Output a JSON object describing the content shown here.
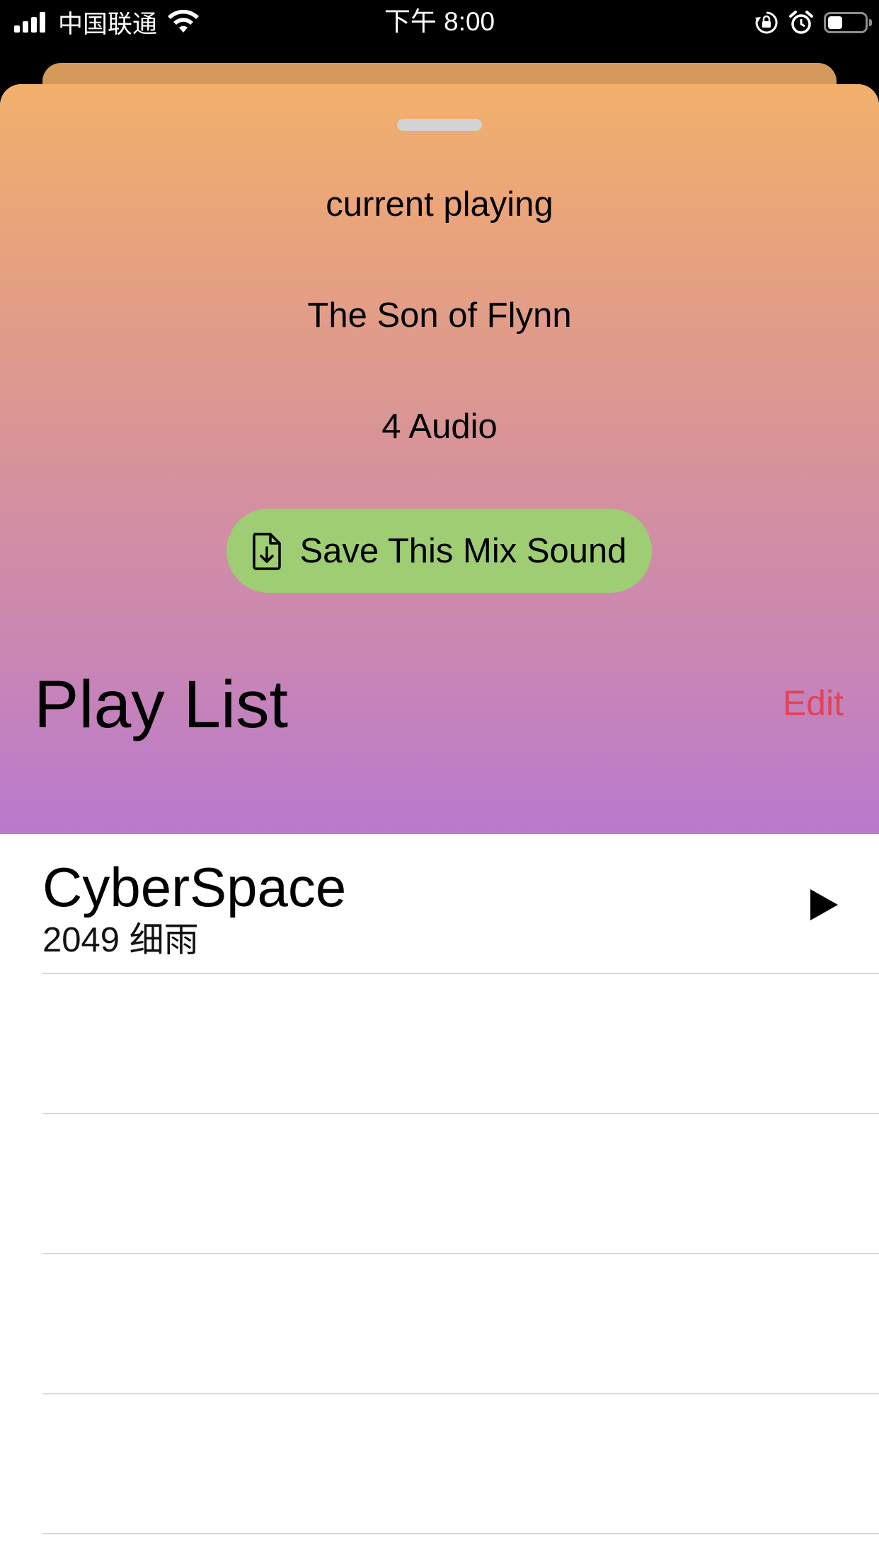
{
  "status_bar": {
    "carrier": "中国联通",
    "time": "下午 8:00",
    "battery_level_percent": 40,
    "icons": [
      "signal-bars-icon",
      "wifi-icon",
      "orientation-lock-icon",
      "alarm-icon",
      "battery-icon"
    ]
  },
  "sheet": {
    "current_label": "current playing",
    "mix_name": "The Son of Flynn",
    "audio_count": "4 Audio",
    "save_button": {
      "label": "Save This Mix Sound",
      "icon": "file-download-icon",
      "color": "#9ECD74"
    }
  },
  "playlist": {
    "title": "Play List",
    "edit_label": "Edit",
    "edit_color": "#E0445A",
    "items": [
      {
        "title": "CyberSpace",
        "subtitle": "2049  细雨",
        "icon": "play-icon"
      },
      {
        "title": "",
        "subtitle": ""
      },
      {
        "title": "",
        "subtitle": ""
      },
      {
        "title": "",
        "subtitle": ""
      },
      {
        "title": "",
        "subtitle": ""
      }
    ]
  }
}
